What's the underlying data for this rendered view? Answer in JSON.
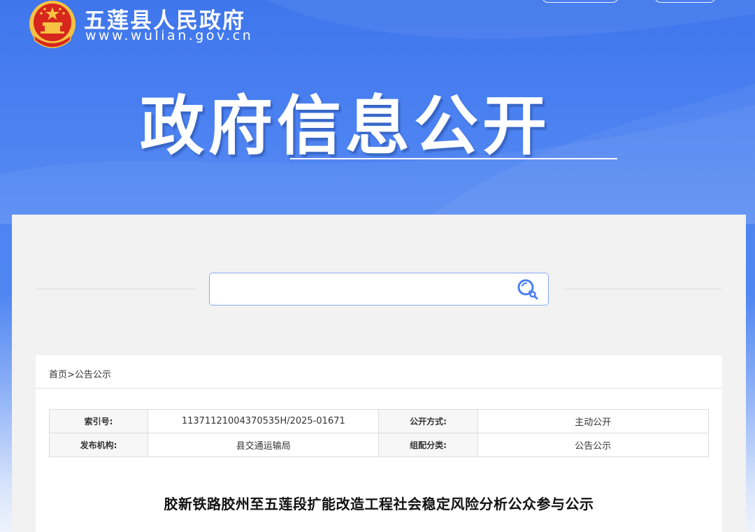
{
  "header": {
    "site_name": "五莲县人民政府",
    "site_url": "www.wulian.gov.cn",
    "hero_title": "政府信息公开",
    "colors": {
      "banner": "#4a7ff0",
      "accent_red": "#d7261d",
      "accent_gold": "#f5c242"
    }
  },
  "search": {
    "placeholder": "",
    "value": "",
    "icon": "search-icon"
  },
  "breadcrumb": {
    "home": "首页",
    "separator": ">",
    "current": "公告公示"
  },
  "meta_table": {
    "rows": [
      {
        "k1": "索引号:",
        "v1": "11371121004370535H/2025-01671",
        "k2": "公开方式:",
        "v2": "主动公开"
      },
      {
        "k1": "发布机构:",
        "v1": "县交通运输局",
        "k2": "组配分类:",
        "v2": "公告公示"
      }
    ]
  },
  "article": {
    "title": "胶新铁路胶州至五莲段扩能改造工程社会稳定风险分析公众参与公示"
  }
}
